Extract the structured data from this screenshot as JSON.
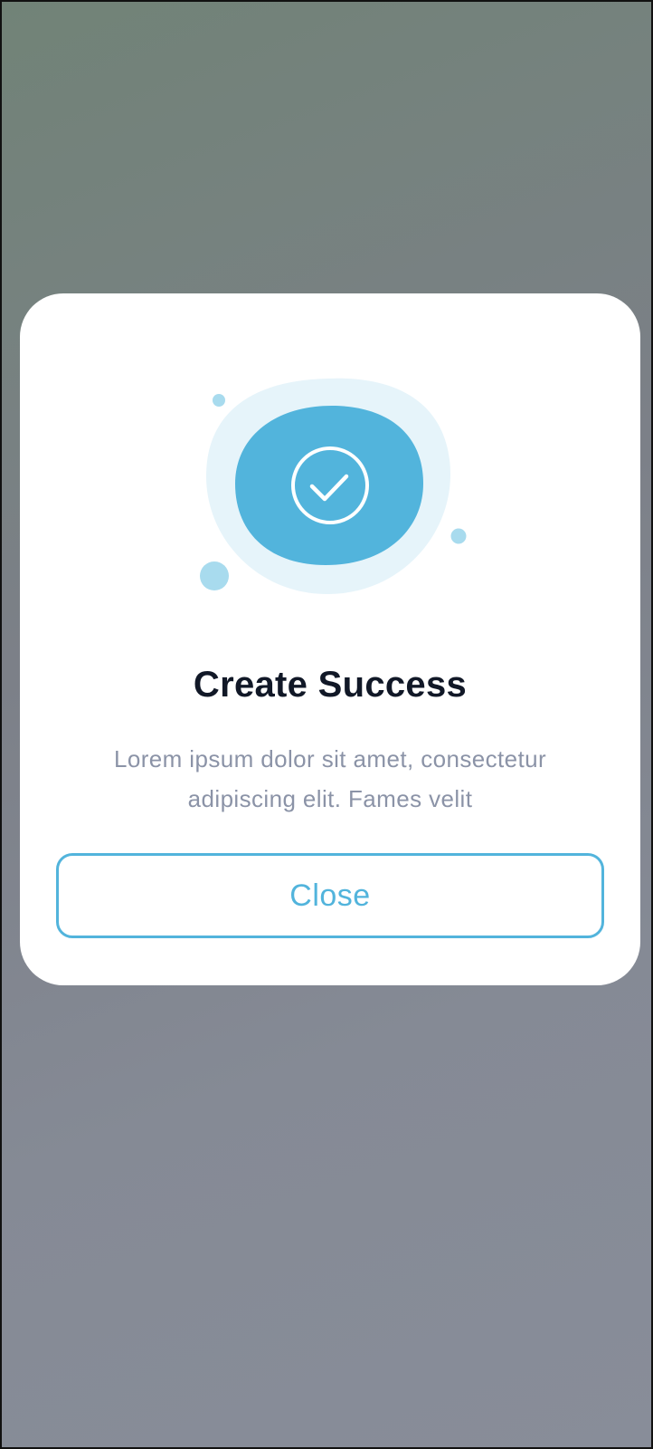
{
  "dialog": {
    "title": "Create Success",
    "description": "Lorem ipsum dolor sit amet, consectetur adipiscing elit. Fames velit",
    "close_label": "Close"
  },
  "icons": {
    "status": "check-circle-icon"
  },
  "colors": {
    "accent": "#52b4dc",
    "accent_light": "#e6f4fa",
    "accent_dot": "#a8dbee",
    "title": "#111827",
    "description": "#8b93a7",
    "backdrop": "#7e838e"
  }
}
